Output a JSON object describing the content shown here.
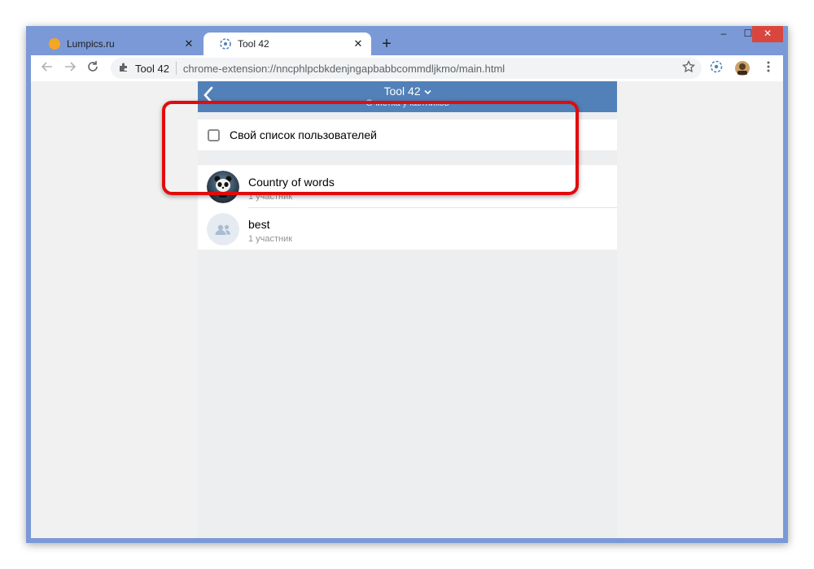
{
  "browser": {
    "tabs": [
      {
        "title": "Lumpics.ru",
        "active": false,
        "favicon_color": "#f5a623"
      },
      {
        "title": "Tool 42",
        "active": true,
        "favicon_color": "#5181b8"
      }
    ],
    "tab_close_glyph": "✕",
    "new_tab_glyph": "+",
    "window_controls": {
      "minimize": "–",
      "maximize": "☐",
      "close": "✕"
    },
    "toolbar": {
      "back_icon": "back-arrow-icon",
      "forward_icon": "forward-arrow-icon",
      "reload_icon": "reload-icon",
      "site_label": "Tool 42",
      "url": "chrome-extension://nncphlpcbkdenjngapbabbcommdljkmo/main.html",
      "bookmark_icon": "star-icon",
      "extension_icon": "tool42-icon",
      "profile_icon": "avatar",
      "menu_icon": "kebab-menu-icon"
    }
  },
  "app": {
    "header": {
      "title": "Tool 42",
      "subtitle": "Очистка участников",
      "back_icon": "chevron-left-icon",
      "title_dropdown_icon": "chevron-down-icon",
      "color": "#5181b8"
    },
    "custom_list": {
      "label": "Свой список пользователей",
      "checked": false
    },
    "conversations": [
      {
        "name": "Country of words",
        "members": "1 участник",
        "avatar": "panda-avatar"
      },
      {
        "name": "best",
        "members": "1 участник",
        "avatar": "group-icon"
      }
    ],
    "highlight_color": "#e20b0b"
  }
}
